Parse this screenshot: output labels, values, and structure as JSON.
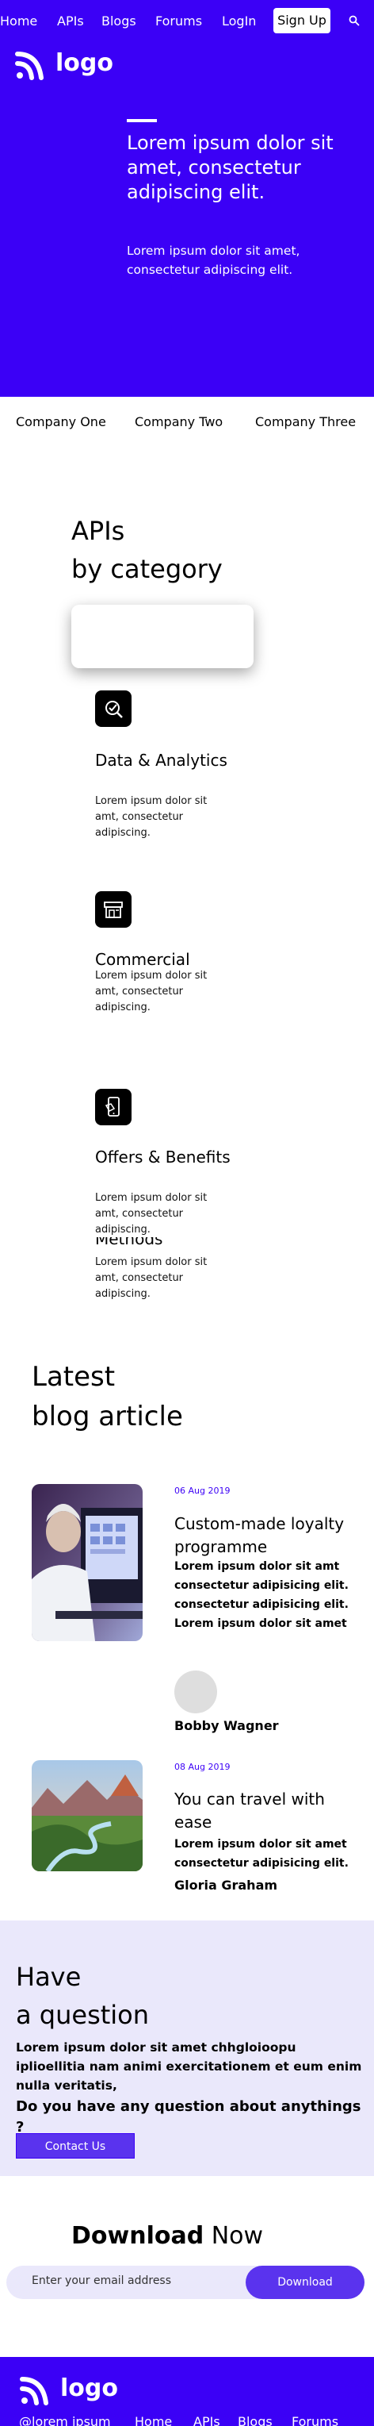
{
  "nav": {
    "links": [
      "Home",
      "APIs",
      "Blogs",
      "Forums",
      "LogIn"
    ],
    "signup": "Sign Up"
  },
  "logo_text": "logo",
  "hero": {
    "title": "Lorem ipsum dolor sit amet, consectetur adipiscing elit.",
    "subtitle": "Lorem ipsum dolor sit amet, consectetur adipiscing elit."
  },
  "companies": [
    "Company One",
    "Company Two",
    "Company Three"
  ],
  "apis": {
    "title_line1": "APIs",
    "title_line2": "by category",
    "categories": [
      {
        "title": "Data & Analytics",
        "desc": "Lorem ipsum dolor sit amt, consectetur adipiscing.",
        "icon": "analytics-icon"
      },
      {
        "title": "Commercial",
        "desc": "Lorem ipsum dolor sit amt, consectetur adipiscing.",
        "icon": "storefront-icon"
      },
      {
        "title": "Offers & Benefits",
        "desc": "Lorem ipsum dolor sit amt, consectetur adipiscing.",
        "icon": "mobile-offer-icon"
      },
      {
        "title": "Methods",
        "desc": "Lorem ipsum dolor sit amt, consectetur adipiscing.",
        "icon": ""
      }
    ]
  },
  "blog": {
    "title_line1": "Latest",
    "title_line2": "blog article",
    "articles": [
      {
        "date": "06 Aug 2019",
        "title": "Custom-made loyalty programme",
        "text": "Lorem ipsum dolor sit amt consectetur adipisicing elit. consectetur adipisicing elit. Lorem ipsum dolor sit amet",
        "author": "Bobby Wagner"
      },
      {
        "date": "08 Aug 2019",
        "title": "You can travel with ease",
        "text": "Lorem ipsum dolor sit amet consectetur adipisicing elit.",
        "author": "Gloria Graham"
      }
    ]
  },
  "question": {
    "title_line1": "Have",
    "title_line2": "a question",
    "text": "Lorem ipsum dolor sit amet chhgloioopu iplioellitia nam animi exercitationem et eum enim nulla veritatis,",
    "ask": "Do you have any question about anythings ?",
    "button": "Contact Us"
  },
  "download": {
    "title_bold": "Download",
    "title_rest": " Now",
    "placeholder": "Enter your email address",
    "button": "Download"
  },
  "footer": {
    "links": [
      "@lorem ipsum",
      "Home",
      "APIs",
      "Blogs",
      "Forums"
    ]
  },
  "colors": {
    "brand": "#3b00f6",
    "button": "#5a33ee",
    "tint": "#eae8fb"
  }
}
